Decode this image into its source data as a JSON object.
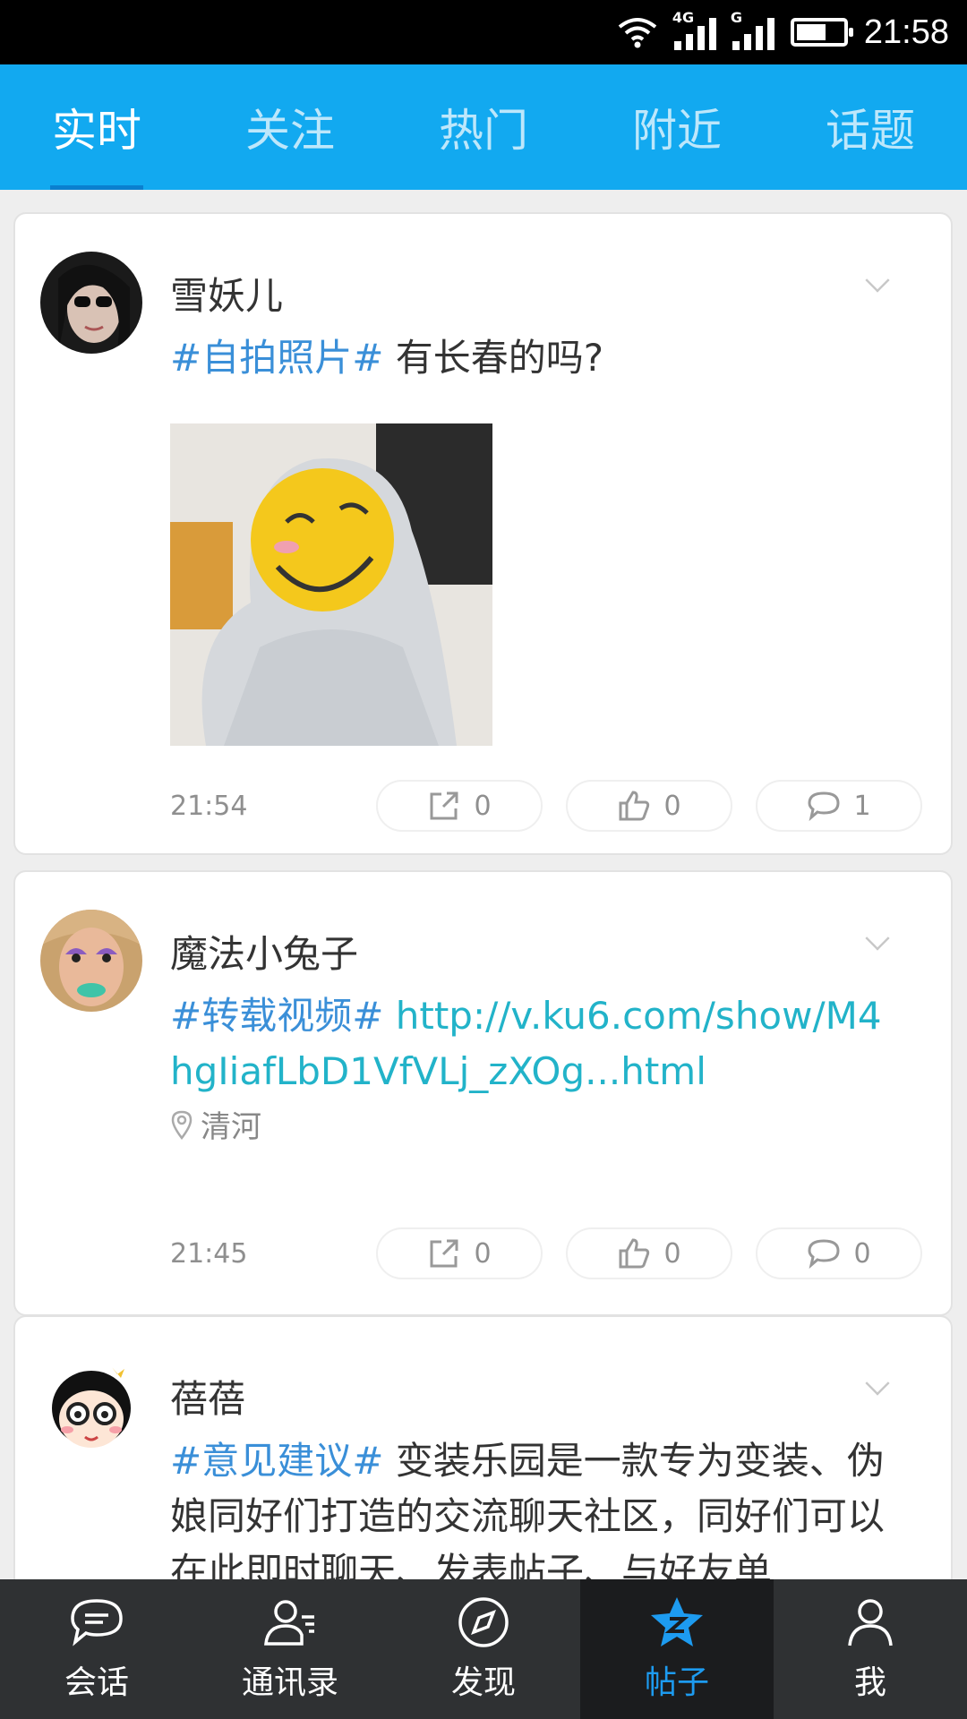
{
  "status_bar": {
    "time": "21:58",
    "network_1": "4G",
    "network_2": "G"
  },
  "top_tabs": [
    {
      "label": "实时",
      "active": true
    },
    {
      "label": "关注",
      "active": false
    },
    {
      "label": "热门",
      "active": false
    },
    {
      "label": "附近",
      "active": false
    },
    {
      "label": "话题",
      "active": false
    }
  ],
  "posts": [
    {
      "username": "雪妖儿",
      "topic": "#自拍照片#",
      "text": " 有长春的吗?",
      "time": "21:54",
      "shares": "0",
      "likes": "0",
      "comments": "1"
    },
    {
      "username": "魔法小兔子",
      "topic": "#转载视频#",
      "link": "http://v.ku6.com/show/M4hgIiafLbD1VfVLj_zXOg...html",
      "location": "清河",
      "time": "21:45",
      "shares": "0",
      "likes": "0",
      "comments": "0"
    },
    {
      "username": "蓓蓓",
      "topic": "#意见建议#",
      "text": " 变装乐园是一款专为变装、伪娘同好们打造的交流聊天社区，同好们可以在此即时聊天、发表帖子、与好友单"
    }
  ],
  "bottom_nav": [
    {
      "label": "会话",
      "icon": "chat-icon"
    },
    {
      "label": "通讯录",
      "icon": "contacts-icon"
    },
    {
      "label": "发现",
      "icon": "compass-icon"
    },
    {
      "label": "帖子",
      "icon": "star-z-icon",
      "active": true
    },
    {
      "label": "我",
      "icon": "person-icon"
    }
  ],
  "colors": {
    "accent": "#12a9f0",
    "topic": "#3a8fd8",
    "link": "#22b3c9",
    "nav_bg": "#2f3133",
    "nav_active": "#1d9bf0"
  }
}
